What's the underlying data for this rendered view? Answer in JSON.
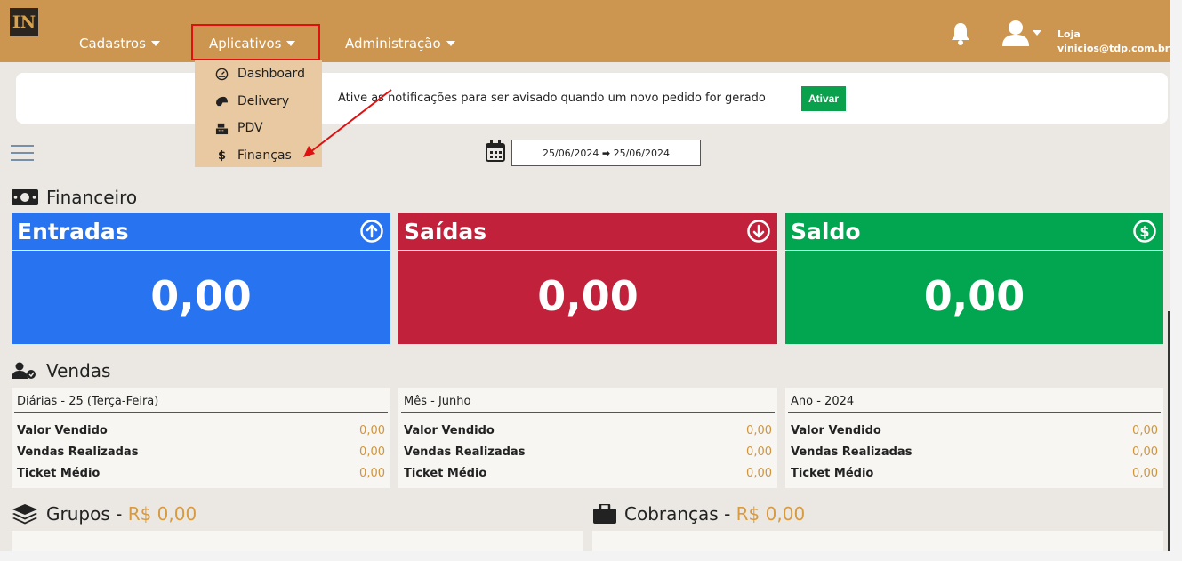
{
  "nav": {
    "logo": "IN",
    "items": [
      {
        "label": "Cadastros"
      },
      {
        "label": "Aplicativos"
      },
      {
        "label": "Administração"
      }
    ],
    "user_name": "Loja",
    "user_email": "vinicios@tdp.com.br"
  },
  "dropdown": {
    "items": [
      {
        "label": "Dashboard",
        "icon": "gauge-icon"
      },
      {
        "label": "Delivery",
        "icon": "helmet-icon"
      },
      {
        "label": "PDV",
        "icon": "cash-register-icon"
      },
      {
        "label": "Finanças",
        "icon": "dollar-icon"
      }
    ]
  },
  "notification": {
    "text": "Ative as notificações para ser avisado quando um novo pedido for gerado",
    "button": "Ativar"
  },
  "date_range": "25/06/2024 ➡ 25/06/2024",
  "financeiro": {
    "title": "Financeiro",
    "cards": [
      {
        "title": "Entradas",
        "value": "0,00",
        "color": "#2874f0",
        "icon": "arrow-up-circle-icon"
      },
      {
        "title": "Saídas",
        "value": "0,00",
        "color": "#c1213a",
        "icon": "arrow-down-circle-icon"
      },
      {
        "title": "Saldo",
        "value": "0,00",
        "color": "#03a650",
        "icon": "dollar-circle-icon"
      }
    ]
  },
  "vendas": {
    "title": "Vendas",
    "panels": [
      {
        "header": "Diárias - 25 (Terça-Feira)",
        "rows": [
          {
            "label": "Valor Vendido",
            "value": "0,00"
          },
          {
            "label": "Vendas Realizadas",
            "value": "0,00"
          },
          {
            "label": "Ticket Médio",
            "value": "0,00"
          }
        ]
      },
      {
        "header": "Mês - Junho",
        "rows": [
          {
            "label": "Valor Vendido",
            "value": "0,00"
          },
          {
            "label": "Vendas Realizadas",
            "value": "0,00"
          },
          {
            "label": "Ticket Médio",
            "value": "0,00"
          }
        ]
      },
      {
        "header": "Ano - 2024",
        "rows": [
          {
            "label": "Valor Vendido",
            "value": "0,00"
          },
          {
            "label": "Vendas Realizadas",
            "value": "0,00"
          },
          {
            "label": "Ticket Médio",
            "value": "0,00"
          }
        ]
      }
    ]
  },
  "grupos": {
    "title": "Grupos - ",
    "value": "R$ 0,00"
  },
  "cobrancas": {
    "title": "Cobranças - ",
    "value": "R$ 0,00"
  }
}
